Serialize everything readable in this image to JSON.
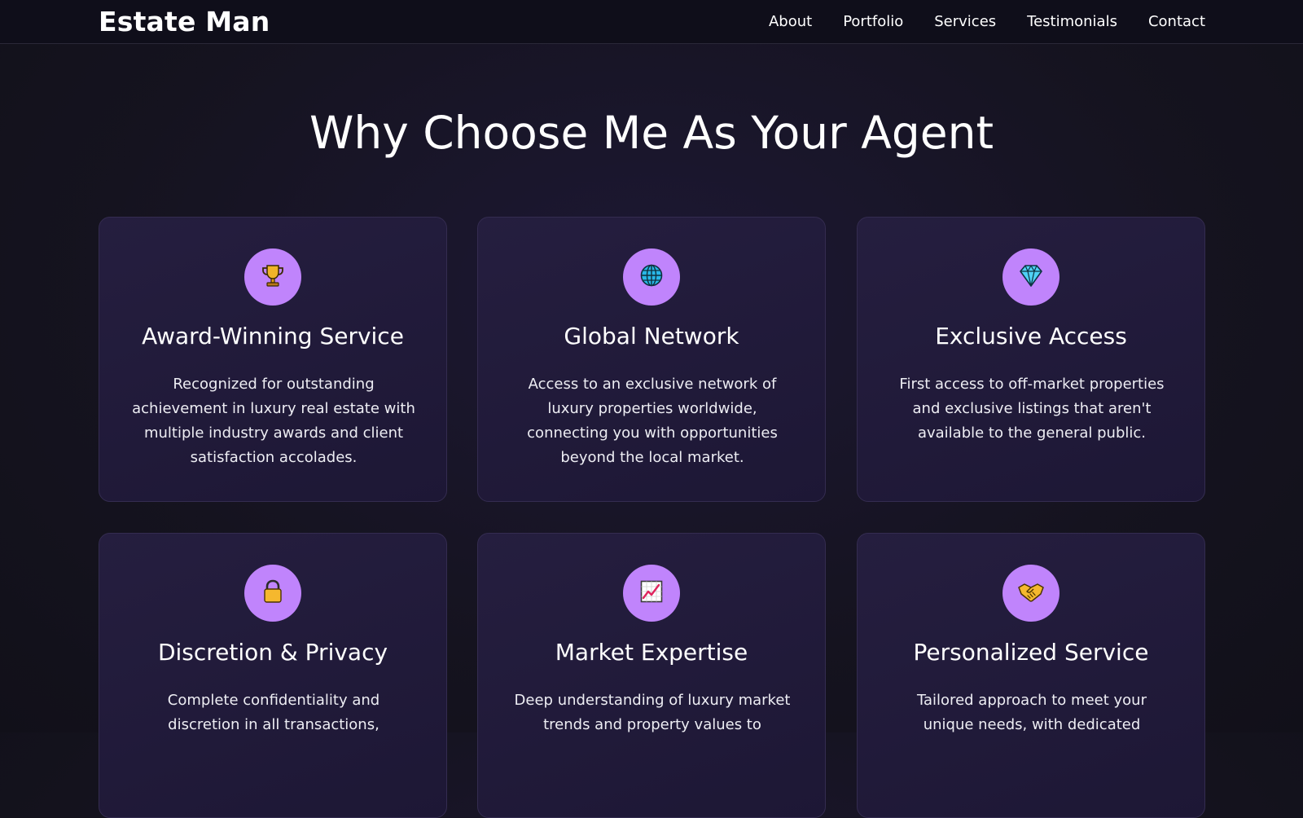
{
  "nav": {
    "brand": "Estate Man",
    "links": [
      {
        "label": "About"
      },
      {
        "label": "Portfolio"
      },
      {
        "label": "Services"
      },
      {
        "label": "Testimonials"
      },
      {
        "label": "Contact"
      }
    ]
  },
  "section": {
    "title": "Why Choose Me As Your Agent"
  },
  "features": [
    {
      "icon": "trophy-icon",
      "title": "Award-Winning Service",
      "description": "Recognized for outstanding achievement in luxury real estate with multiple industry awards and client satisfaction accolades."
    },
    {
      "icon": "globe-icon",
      "title": "Global Network",
      "description": "Access to an exclusive network of luxury properties worldwide, connecting you with opportunities beyond the local market."
    },
    {
      "icon": "diamond-icon",
      "title": "Exclusive Access",
      "description": "First access to off-market properties and exclusive listings that aren't available to the general public."
    },
    {
      "icon": "lock-icon",
      "title": "Discretion & Privacy",
      "description": "Complete confidentiality and discretion in all transactions,"
    },
    {
      "icon": "chart-increasing-icon",
      "title": "Market Expertise",
      "description": "Deep understanding of luxury market trends and property values to"
    },
    {
      "icon": "handshake-icon",
      "title": "Personalized Service",
      "description": "Tailored approach to meet your unique needs, with dedicated"
    }
  ],
  "colors": {
    "accent": "#c084fc",
    "nav_background": "#0f0e1a",
    "page_background": "#15131f",
    "card_background": "#231c3c"
  }
}
